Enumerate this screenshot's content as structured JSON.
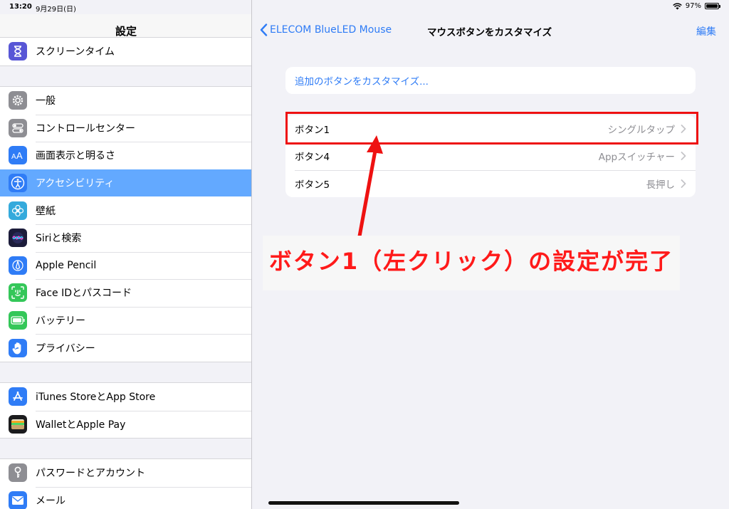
{
  "status": {
    "time": "13:20",
    "date": "9月29日(日)",
    "battery": "97%",
    "battery_level": 0.97
  },
  "sidebar": {
    "title": "設定",
    "groups": [
      [
        {
          "label": "スクリーンタイム",
          "icon": "hourglass-icon",
          "color": "#5856d6"
        }
      ],
      [
        {
          "label": "一般",
          "icon": "gear-icon",
          "color": "#8e8e93"
        },
        {
          "label": "コントロールセンター",
          "icon": "toggles-icon",
          "color": "#8e8e93"
        },
        {
          "label": "画面表示と明るさ",
          "icon": "text-size-icon",
          "color": "#2f7cf6"
        },
        {
          "label": "アクセシビリティ",
          "icon": "accessibility-icon",
          "color": "#2f7cf6",
          "selected": true
        },
        {
          "label": "壁紙",
          "icon": "flower-icon",
          "color": "#34aadc"
        },
        {
          "label": "Siriと検索",
          "icon": "siri-icon",
          "color": "#1c1c3a"
        },
        {
          "label": "Apple Pencil",
          "icon": "pencil-icon",
          "color": "#2f7cf6"
        },
        {
          "label": "Face IDとパスコード",
          "icon": "face-id-icon",
          "color": "#34c759"
        },
        {
          "label": "バッテリー",
          "icon": "battery-icon",
          "color": "#34c759"
        },
        {
          "label": "プライバシー",
          "icon": "hand-icon",
          "color": "#2f7cf6"
        }
      ],
      [
        {
          "label": "iTunes StoreとApp Store",
          "icon": "app-store-icon",
          "color": "#2f7cf6"
        },
        {
          "label": "WalletとApple Pay",
          "icon": "wallet-icon",
          "color": "#1c1c1e"
        }
      ],
      [
        {
          "label": "パスワードとアカウント",
          "icon": "key-icon",
          "color": "#8e8e93"
        },
        {
          "label": "メール",
          "icon": "mail-icon",
          "color": "#2f7cf6"
        }
      ]
    ]
  },
  "detail": {
    "back_label": "ELECOM BlueLED Mouse",
    "title": "マウスボタンをカスタマイズ",
    "edit_label": "編集",
    "customize_more": "追加のボタンをカスタマイズ...",
    "buttons": [
      {
        "label": "ボタン1",
        "value": "シングルタップ"
      },
      {
        "label": "ボタン4",
        "value": "Appスイッチャー"
      },
      {
        "label": "ボタン5",
        "value": "長押し"
      }
    ],
    "annotation": "ボタン1（左クリック）の設定が完了"
  },
  "colors": {
    "accent": "#2f7cf6",
    "selected_row": "#63a9ff",
    "annotation_red": "#ee1111"
  }
}
